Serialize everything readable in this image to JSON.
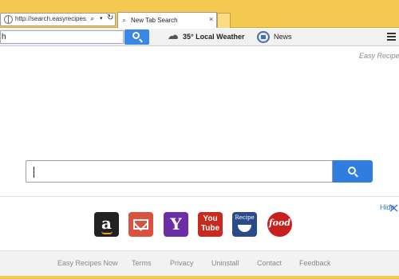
{
  "browser": {
    "address_text": "http://search.easyrecipes...",
    "tab_title": "New Tab Search",
    "tab_close": "×",
    "search_icon_char": "⌕",
    "dropdown_char": "▾",
    "refresh_char": "↻"
  },
  "toolbar": {
    "search_value": "h",
    "weather_label": "35° Local Weather",
    "news_label": "News"
  },
  "page": {
    "brand": "Easy Recipes",
    "search_value": "",
    "hide_label": "Hide"
  },
  "tiles": {
    "amazon_letter": "a",
    "yahoo_letter": "Y",
    "youtube_top": "You",
    "youtube_bottom": "Tube",
    "recipe_label": "Recipe",
    "food_label": "food"
  },
  "footer": {
    "links": [
      "Easy Recipes Now",
      "Terms",
      "Privacy",
      "Uninstall",
      "Contact",
      "Feedback"
    ]
  },
  "colors": {
    "chrome": "#f4c950",
    "search_button": "#2f7de1",
    "link": "#3b73d1"
  }
}
